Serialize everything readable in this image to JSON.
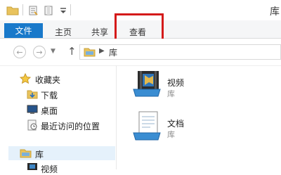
{
  "window": {
    "title": "库"
  },
  "ribbon": {
    "tabs": [
      {
        "label": "文件"
      },
      {
        "label": "主页"
      },
      {
        "label": "共享"
      },
      {
        "label": "查看"
      }
    ]
  },
  "address": {
    "path": [
      "库"
    ]
  },
  "nav": {
    "favorites_label": "收藏夹",
    "favorites": [
      {
        "label": "下载",
        "icon": "download-folder-icon"
      },
      {
        "label": "桌面",
        "icon": "desktop-icon"
      },
      {
        "label": "最近访问的位置",
        "icon": "recent-places-icon"
      }
    ],
    "libraries_label": "库",
    "libraries": [
      {
        "label": "视频",
        "icon": "video-library-icon"
      }
    ]
  },
  "content": {
    "items": [
      {
        "name": "视频",
        "type": "库",
        "icon": "video-library-icon"
      },
      {
        "name": "文档",
        "type": "库",
        "icon": "document-library-icon"
      }
    ]
  },
  "colors": {
    "accent": "#1979ca",
    "highlight": "#d41a1a"
  }
}
